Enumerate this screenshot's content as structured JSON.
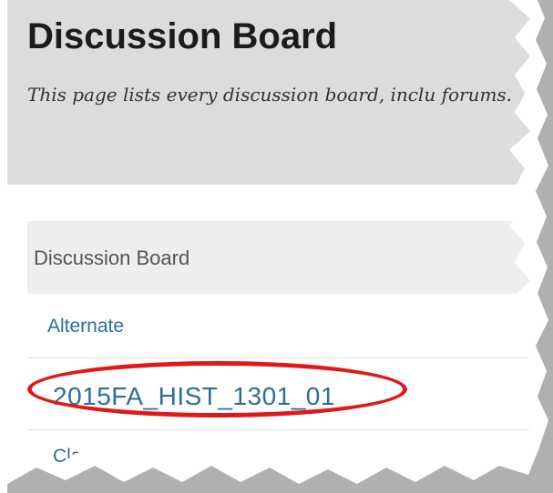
{
  "page": {
    "title": "Discussion Board",
    "description": "This page lists every discussion board, inclu forums."
  },
  "list": {
    "header_label": "Discussion Board",
    "items": [
      {
        "label": "Alternate"
      },
      {
        "label": "2015FA_HIST_1301_01"
      },
      {
        "label": "Clas"
      }
    ]
  },
  "colors": {
    "link": "#2a6e9c",
    "highlight": "#e01818",
    "header_bg": "#dcdcdc"
  }
}
